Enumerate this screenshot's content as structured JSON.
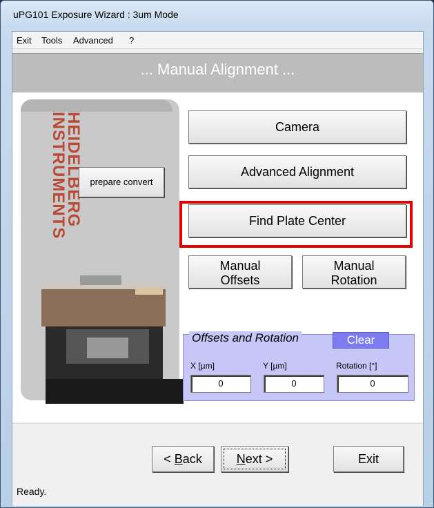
{
  "window": {
    "title": "uPG101 Exposure Wizard : 3um Mode"
  },
  "menu": {
    "items": [
      "Exit",
      "Tools",
      "Advanced",
      "?"
    ]
  },
  "banner": {
    "text": "... Manual Alignment ..."
  },
  "logo": {
    "line1": "HEIDELBERG",
    "line2": "INSTRUMENTS"
  },
  "buttons": {
    "prepare_convert": "prepare convert",
    "camera": "Camera",
    "advanced_alignment": "Advanced Alignment",
    "find_plate_center": "Find Plate Center",
    "manual_offsets_line1": "Manual",
    "manual_offsets_line2": "Offsets",
    "manual_rotation_line1": "Manual",
    "manual_rotation_line2": "Rotation"
  },
  "offsets_group": {
    "title": "Offsets and Rotation",
    "clear": "Clear",
    "x_label": "X [µm]",
    "y_label": "Y [µm]",
    "rot_label": "Rotation [°]",
    "x_value": "0",
    "y_value": "0",
    "rot_value": "0"
  },
  "footer": {
    "back_prefix": "< ",
    "back_mnemonic": "B",
    "back_rest": "ack",
    "next_mnemonic": "N",
    "next_rest": "ext >",
    "exit": "Exit",
    "status": "Ready."
  },
  "colors": {
    "highlight": "#e60000",
    "brand": "#b94a36",
    "group_bg": "#c6c6f7",
    "clear_bg": "#7c7cf0"
  }
}
